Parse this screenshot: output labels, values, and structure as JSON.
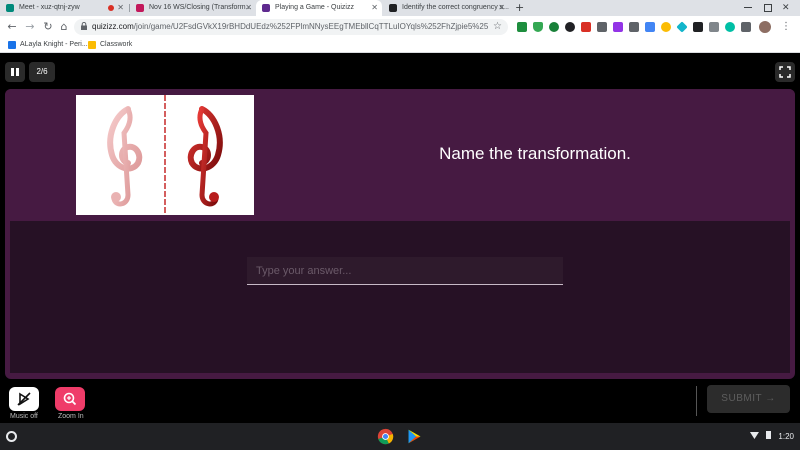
{
  "browser": {
    "tabs": [
      {
        "title": "Meet - xuz-qtnj-zyw",
        "favicon_color": "#00897b",
        "recording": true
      },
      {
        "title": "Nov 16 WS/Closing (Transform...",
        "favicon_color": "#c2185b"
      },
      {
        "title": "Playing a Game - Quizizz",
        "favicon_color": "#5f2a8f"
      },
      {
        "title": "Identify the correct congruency s...",
        "favicon_color": "#202124"
      }
    ],
    "new_tab_label": "+",
    "url_domain": "quizizz.com",
    "url_path": "/join/game/U2FsdGVkX19rBHDdUEdz%252FPlmNNysEEgTMEbllCqTTLuIOYqls%252FhZjpie5%252BjREwl...",
    "bookmarks": [
      {
        "label": "ALayla Knight - Peri...",
        "icon_color": "#1a73e8"
      },
      {
        "label": "Classwork",
        "icon_color": "#fbbc04"
      }
    ]
  },
  "game": {
    "question_counter": "2/6",
    "question_text": "Name the transformation.",
    "answer_placeholder": "Type your answer...",
    "music_label": "Music off",
    "zoom_label": "Zoom In",
    "submit_label": "SUBMIT",
    "accent_zoom": "#ef3c69",
    "card_color": "#461a42",
    "answer_bg": "#261125"
  },
  "shelf": {
    "time": "1:20"
  }
}
